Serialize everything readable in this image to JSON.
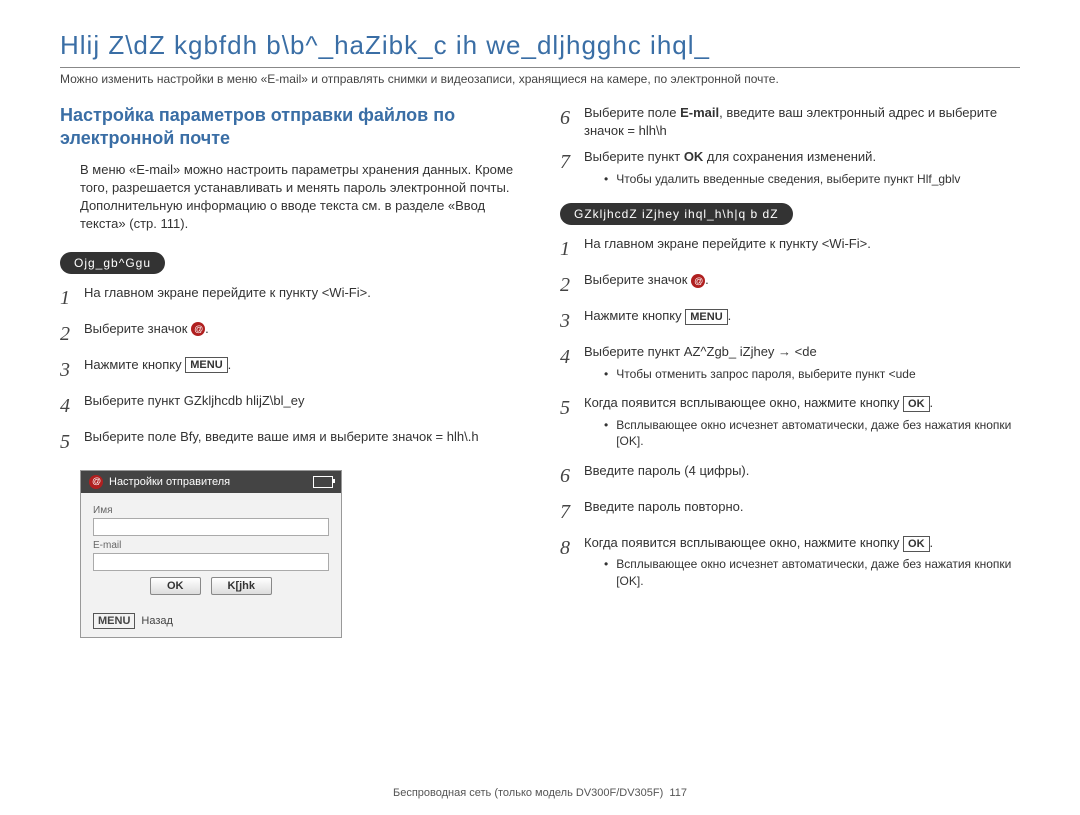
{
  "page_title": "Hlij Z\\dZ kgbfdh b\\b^_haZibk_c ih we_dljhgghc ihql_",
  "intro": "Можно изменить настройки в меню «E-mail» и отправлять снимки и видеозаписи, хранящиеся на камере, по электронной почте.",
  "left": {
    "section_title": "Настройка параметров отправки файлов по электронной почте",
    "paragraph": "В меню «E-mail» можно настроить параметры хранения данных. Кроме того, разрешается устанавливать и менять пароль электронной почты. Дополнительную информацию о вводе текста см. в разделе «Ввод текста» (стр. 111).",
    "pill": "Ojg_gb^Ggu",
    "steps": [
      {
        "text": "На главном экране перейдите к пункту <Wi-Fi>."
      },
      {
        "text_pre": "Выберите значок ",
        "icon": true,
        "text_post": "."
      },
      {
        "text_pre": "Нажмите кнопку ",
        "btn": "MENU",
        "text_post": "."
      },
      {
        "text": "Выберите пункт GZkljhcdb hlijZ\\bl_ey"
      },
      {
        "text": "Выберите поле Bfy, введите ваше имя и выберите значок = hlh\\.h"
      }
    ],
    "device": {
      "header": "Настройки отправителя",
      "lbl_name": "Имя",
      "lbl_email": "E-mail",
      "btn_ok": "OK",
      "btn_reset": "K[jhk",
      "menu": "MENU",
      "back": "Назад"
    }
  },
  "right": {
    "top_steps": [
      {
        "num": "6",
        "text_pre": "Выберите поле ",
        "bold": "E-mail",
        "text_post": ", введите ваш электронный адрес и выберите значок = hlh\\h"
      },
      {
        "num": "7",
        "text_pre": "Выберите пункт ",
        "bold": "OK",
        "text_post": " для сохранения изменений.",
        "bullets": [
          "Чтобы удалить введенные сведения, выберите пункт Hlf_gblv"
        ]
      }
    ],
    "pill": "GZkljhcdZ iZjhey ihql_h\\h|q b dZ",
    "steps": [
      {
        "num": "1",
        "text": "На главном экране перейдите к пункту <Wi-Fi>."
      },
      {
        "num": "2",
        "text_pre": "Выберите значок ",
        "icon": true,
        "text_post": "."
      },
      {
        "num": "3",
        "text_pre": "Нажмите кнопку ",
        "btn": "MENU",
        "text_post": "."
      },
      {
        "num": "4",
        "text": "Выберите пункт AZ^Zgb_ iZjhey → <de",
        "bullets": [
          "Чтобы отменить запрос пароля, выберите пункт <ude"
        ]
      },
      {
        "num": "5",
        "text_pre": "Когда появится всплывающее окно, нажмите кнопку ",
        "btn": "OK",
        "text_post": ".",
        "bullets": [
          "Всплывающее окно исчезнет автоматически, даже без нажатия кнопки [OK]."
        ]
      },
      {
        "num": "6",
        "text": "Введите пароль (4 цифры)."
      },
      {
        "num": "7",
        "text": "Введите пароль повторно."
      },
      {
        "num": "8",
        "text_pre": "Когда появится всплывающее окно, нажмите кнопку ",
        "btn": "OK",
        "text_post": ".",
        "bullets": [
          "Всплывающее окно исчезнет автоматически, даже без нажатия кнопки [OK]."
        ]
      }
    ]
  },
  "footer": {
    "text": "Беспроводная сеть (только модель DV300F/DV305F)",
    "page": "117"
  }
}
